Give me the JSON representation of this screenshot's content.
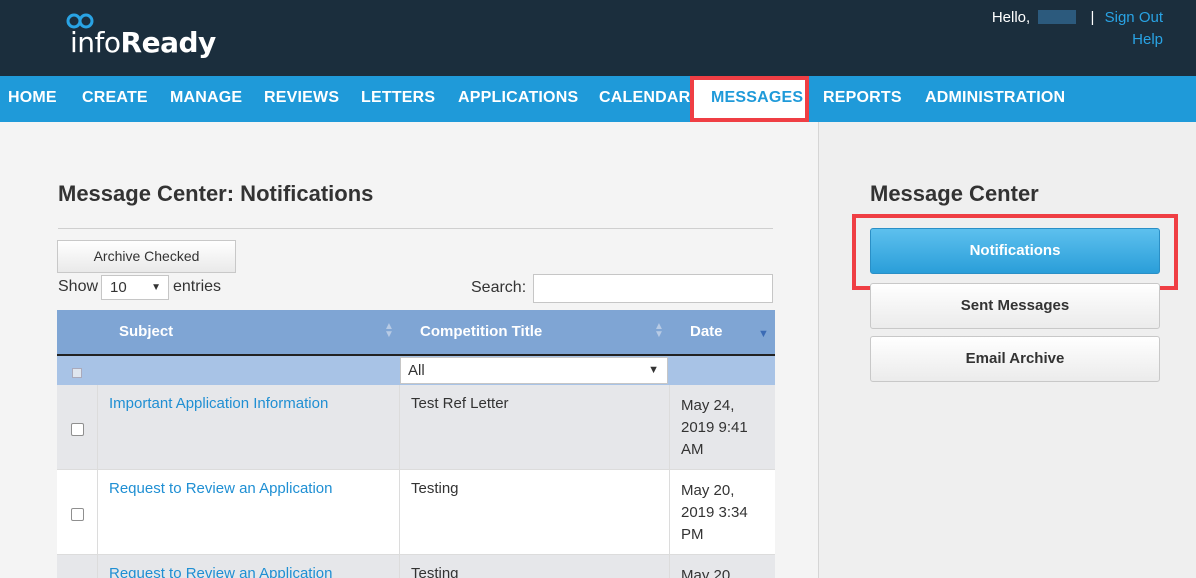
{
  "header": {
    "logo_prefix": "info",
    "logo_suffix": "Ready",
    "greeting": "Hello,",
    "sign_out": "Sign Out",
    "help": "Help"
  },
  "nav": {
    "items": [
      {
        "label": "HOME"
      },
      {
        "label": "CREATE"
      },
      {
        "label": "MANAGE"
      },
      {
        "label": "REVIEWS"
      },
      {
        "label": "LETTERS"
      },
      {
        "label": "APPLICATIONS"
      },
      {
        "label": "CALENDAR"
      },
      {
        "label": "MESSAGES",
        "active": true
      },
      {
        "label": "REPORTS"
      },
      {
        "label": "ADMINISTRATION"
      }
    ]
  },
  "main": {
    "title": "Message Center: Notifications",
    "archive_button": "Archive Checked",
    "show_label": "Show",
    "entries_value": "10",
    "entries_label": "entries",
    "search_label": "Search:",
    "search_value": "",
    "columns": [
      "Subject",
      "Competition Title",
      "Date"
    ],
    "filter_value": "All",
    "rows": [
      {
        "subject": "Important Application Information",
        "competition": "Test Ref Letter",
        "date": "May 24, 2019 9:41 AM"
      },
      {
        "subject": "Request to Review an Application",
        "competition": "Testing",
        "date": "May 20, 2019 3:34 PM"
      },
      {
        "subject": "Request to Review an Application",
        "competition": "Testing",
        "date": "May 20,"
      }
    ]
  },
  "sidebar": {
    "title": "Message Center",
    "buttons": [
      {
        "label": "Notifications",
        "active": true
      },
      {
        "label": "Sent Messages"
      },
      {
        "label": "Email Archive"
      }
    ]
  },
  "colors": {
    "header_bg": "#1b2e3d",
    "nav_bg": "#1f9ad9",
    "highlight": "#ef3e44",
    "link": "#1f8fd3",
    "table_header": "#7fa5d4"
  }
}
